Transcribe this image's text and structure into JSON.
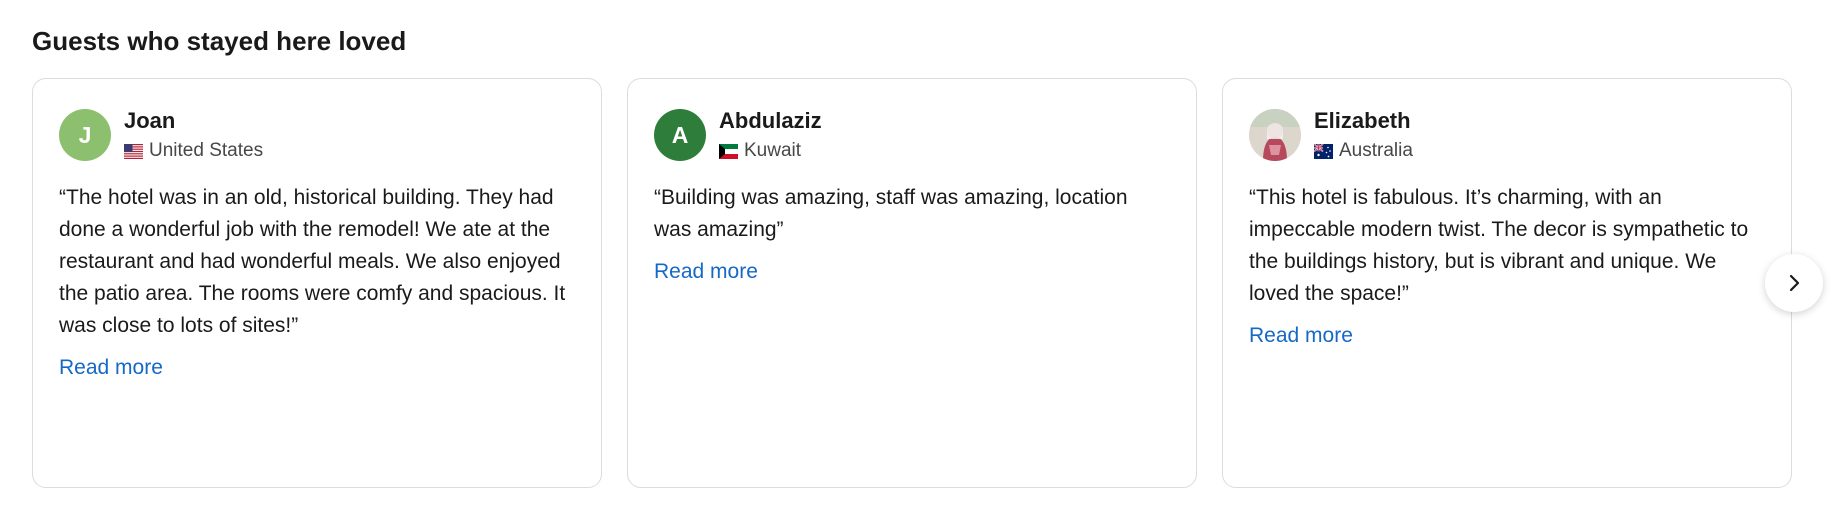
{
  "section": {
    "title": "Guests who stayed here loved"
  },
  "reviews": [
    {
      "name": "Joan",
      "initial": "J",
      "avatar_color": "#8cc06e",
      "country": "United States",
      "flag": "us-flag-icon",
      "text": "“The hotel was in an old, historical building. They had done a wonderful job with the remodel! We ate at the restaurant and had wonderful meals. We also enjoyed the patio area. The rooms were comfy and spacious. It was close to lots of sites!”",
      "read_more": "Read more"
    },
    {
      "name": "Abdulaziz",
      "initial": "A",
      "avatar_color": "#2f7d3a",
      "country": "Kuwait",
      "flag": "kuwait-flag-icon",
      "text": "“Building was amazing, staff was amazing, location was amazing”",
      "read_more": "Read more"
    },
    {
      "name": "Elizabeth",
      "avatar_image": "user-photo",
      "country": "Australia",
      "flag": "australia-flag-icon",
      "text": "“This hotel is fabulous. It’s charming, with an impeccable modern twist. The decor is sympathetic to the buildings history, but is vibrant and unique. We loved the space!”",
      "read_more": "Read more"
    }
  ],
  "carousel": {
    "next_icon": "chevron-right-icon"
  },
  "colors": {
    "link": "#1668c7",
    "card_border": "#dcdcdc",
    "text": "#1a1a1a",
    "muted_text": "#474747"
  }
}
